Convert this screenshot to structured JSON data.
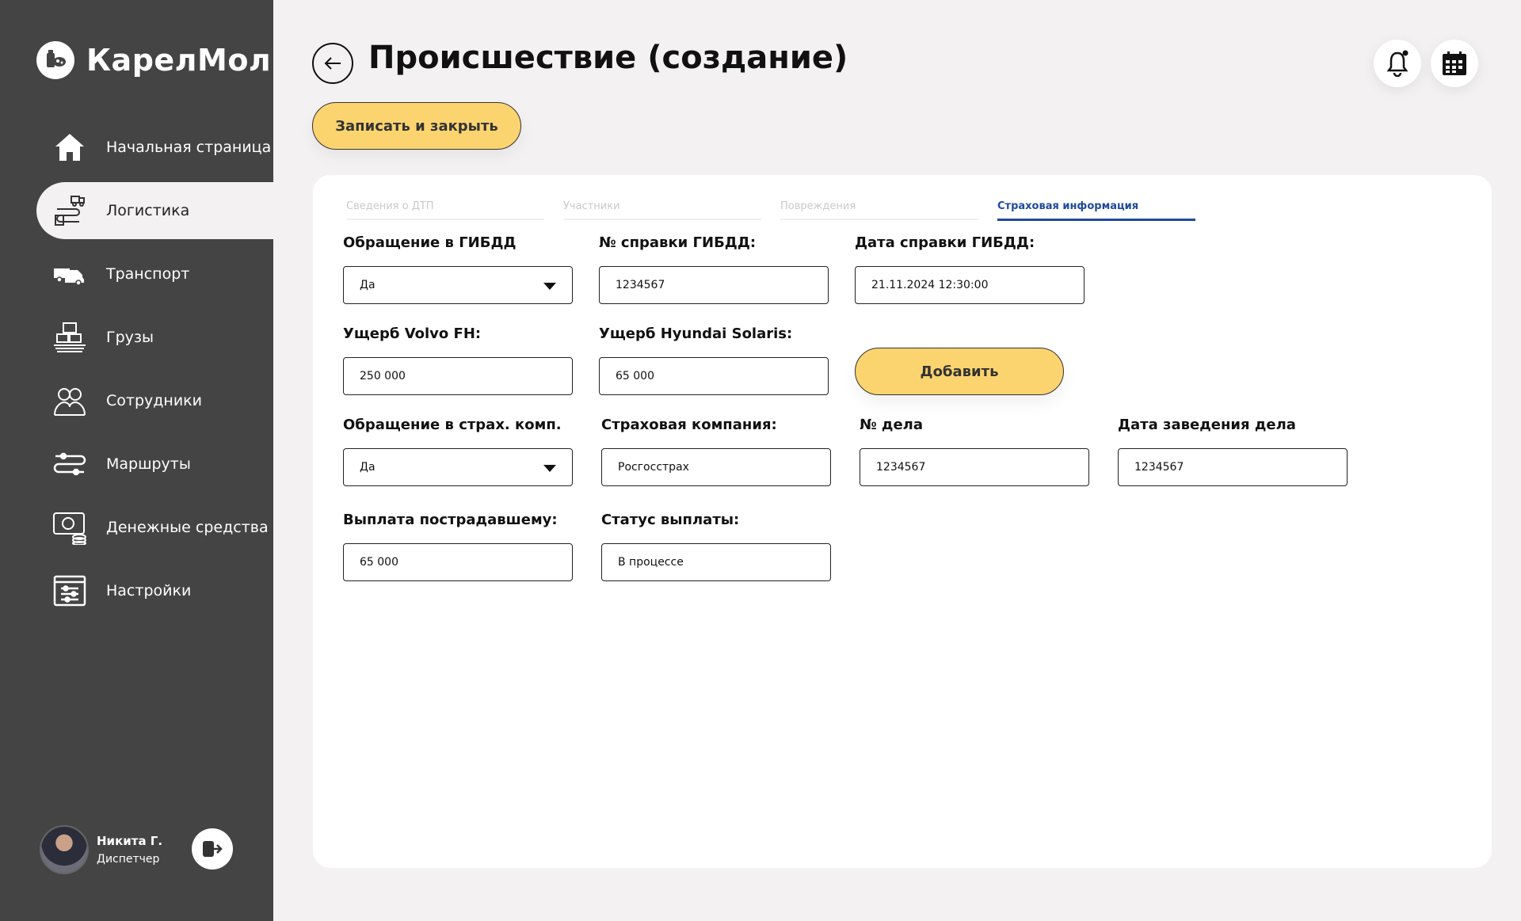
{
  "sidebar": {
    "logo_text": "КарелМол",
    "items": [
      {
        "label": "Начальная страница",
        "icon": "home-icon"
      },
      {
        "label": "Логистика",
        "icon": "logistics-icon"
      },
      {
        "label": "Транспорт",
        "icon": "truck-icon"
      },
      {
        "label": "Грузы",
        "icon": "cargo-icon"
      },
      {
        "label": "Сотрудники",
        "icon": "employees-icon"
      },
      {
        "label": "Маршруты",
        "icon": "routes-icon"
      },
      {
        "label": "Денежные средства",
        "icon": "money-icon"
      },
      {
        "label": "Настройки",
        "icon": "settings-icon"
      }
    ],
    "active_item": "Логистика",
    "user": {
      "name": "Никита Г.",
      "role": "Диспетчер"
    }
  },
  "header": {
    "title": "Происшествие (создание)",
    "save_label": "Записать и закрыть"
  },
  "tabs": [
    {
      "label": "Сведения о ДТП"
    },
    {
      "label": "Участники"
    },
    {
      "label": "Повреждения"
    },
    {
      "label": "Страховая информация"
    }
  ],
  "active_tab": "Страховая информация",
  "form": {
    "gibdd_appeal": {
      "label": "Обращение в ГИБДД",
      "value": "Да"
    },
    "gibdd_ref_no": {
      "label": "№ справки ГИБДД:",
      "value": "1234567"
    },
    "gibdd_ref_date": {
      "label": "Дата справки ГИБДД:",
      "value": "21.11.2024 12:30:00"
    },
    "damage_volvo": {
      "label": "Ущерб Volvo FH:",
      "value": "250 000"
    },
    "damage_hyundai": {
      "label": "Ущерб Hyundai Solaris:",
      "value": "65 000"
    },
    "add_label": "Добавить",
    "insurance_appeal": {
      "label": "Обращение в страх. комп.",
      "value": "Да"
    },
    "insurance_company": {
      "label": "Страховая компания:",
      "value": "Росгосстрах"
    },
    "case_no": {
      "label": "№ дела",
      "value": "1234567"
    },
    "case_date": {
      "label": "Дата заведения дела",
      "value": "1234567"
    },
    "payout": {
      "label": "Выплата пострадавшему:",
      "value": "65 000"
    },
    "payout_status": {
      "label": "Статус выплаты:",
      "value": "В процессе"
    }
  },
  "colors": {
    "sidebar_bg": "#444444",
    "accent_yellow": "#fcd46f",
    "active_tab": "#1f4a9c",
    "page_bg": "#f3f1f2"
  }
}
